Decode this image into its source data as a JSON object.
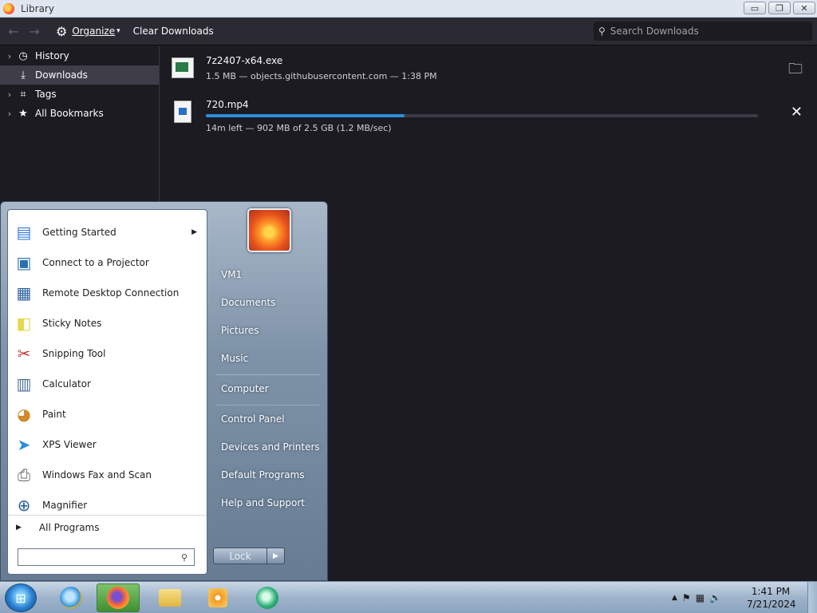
{
  "window": {
    "title": "Library",
    "buttons": {
      "minimize": "▭",
      "restore": "❐",
      "close": "✕"
    }
  },
  "toolbar": {
    "organize_label": "Organize",
    "clear_label": "Clear Downloads",
    "search_placeholder": "Search Downloads"
  },
  "sidebar": {
    "items": [
      {
        "label": "History",
        "icon": "clock-icon",
        "expandable": true,
        "selected": false
      },
      {
        "label": "Downloads",
        "icon": "download-icon",
        "expandable": false,
        "selected": true
      },
      {
        "label": "Tags",
        "icon": "tag-icon",
        "expandable": true,
        "selected": false
      },
      {
        "label": "All Bookmarks",
        "icon": "star-icon",
        "expandable": true,
        "selected": false
      }
    ]
  },
  "downloads": [
    {
      "name": "7z2407-x64.exe",
      "status": "1.5 MB — objects.githubusercontent.com — 1:38 PM",
      "action_icon": "folder-icon"
    },
    {
      "name": "720.mp4",
      "status": "14m left — 902 MB of 2.5 GB (1.2 MB/sec)",
      "progress": 0.36,
      "action_icon": "cancel-icon"
    }
  ],
  "startmenu": {
    "programs": [
      {
        "label": "Getting Started",
        "icon": "getting-started-icon",
        "has_submenu": true
      },
      {
        "label": "Connect to a Projector",
        "icon": "projector-icon",
        "has_submenu": false
      },
      {
        "label": "Remote Desktop Connection",
        "icon": "remote-desktop-icon",
        "has_submenu": false
      },
      {
        "label": "Sticky Notes",
        "icon": "sticky-notes-icon",
        "has_submenu": false
      },
      {
        "label": "Snipping Tool",
        "icon": "scissors-icon",
        "has_submenu": false
      },
      {
        "label": "Calculator",
        "icon": "calculator-icon",
        "has_submenu": false
      },
      {
        "label": "Paint",
        "icon": "paint-palette-icon",
        "has_submenu": false
      },
      {
        "label": "XPS Viewer",
        "icon": "xps-viewer-icon",
        "has_submenu": false
      },
      {
        "label": "Windows Fax and Scan",
        "icon": "fax-icon",
        "has_submenu": false
      },
      {
        "label": "Magnifier",
        "icon": "magnifier-icon",
        "has_submenu": false
      }
    ],
    "all_programs_label": "All Programs",
    "search_value": "",
    "right_links": [
      "VM1",
      "Documents",
      "Pictures",
      "Music",
      "Computer",
      "Control Panel",
      "Devices and Printers",
      "Default Programs",
      "Help and Support"
    ],
    "lock_label": "Lock"
  },
  "taskbar": {
    "time": "1:41 PM",
    "date": "7/21/2024",
    "apps": [
      "internet-explorer-icon",
      "firefox-icon",
      "file-explorer-icon",
      "media-player-icon",
      "app-icon"
    ]
  }
}
